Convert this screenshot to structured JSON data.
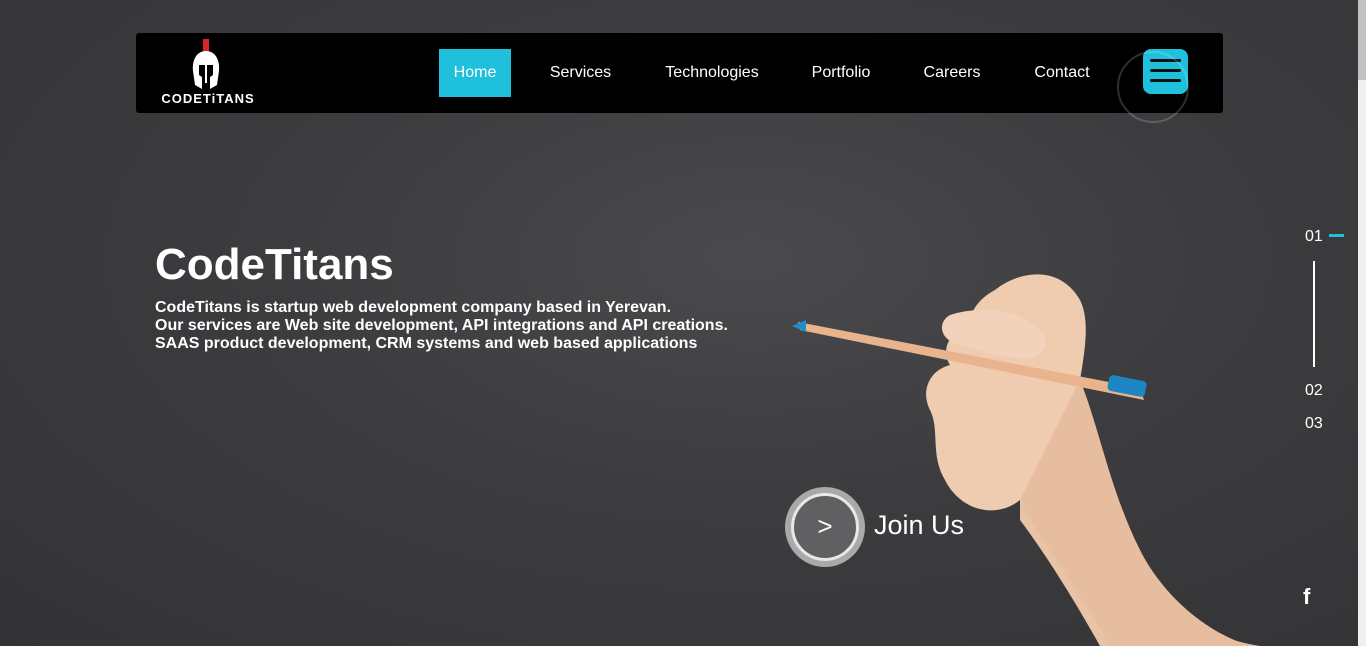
{
  "nav": {
    "logo_text": "CODETiTANS",
    "items": [
      {
        "label": "Home",
        "active": true
      },
      {
        "label": "Services",
        "active": false
      },
      {
        "label": "Technologies",
        "active": false
      },
      {
        "label": "Portfolio",
        "active": false
      },
      {
        "label": "Careers",
        "active": false
      },
      {
        "label": "Contact",
        "active": false
      }
    ],
    "menu_icon": "hamburger-menu-icon"
  },
  "hero": {
    "title": "CodeTitans",
    "description_lines": [
      "CodeTitans is startup web development company based in Yerevan.",
      "Our services are Web site development, API integrations and API creations.",
      "SAAS product development, CRM systems and web based applications"
    ],
    "join_button_glyph": ">",
    "join_label": "Join Us"
  },
  "slides": {
    "items": [
      "01",
      "02",
      "03"
    ],
    "active_index": 0
  },
  "social": {
    "facebook_glyph": "f"
  },
  "colors": {
    "accent": "#1fc0dc",
    "navbar": "#000000",
    "background": "#3c3c3f"
  }
}
